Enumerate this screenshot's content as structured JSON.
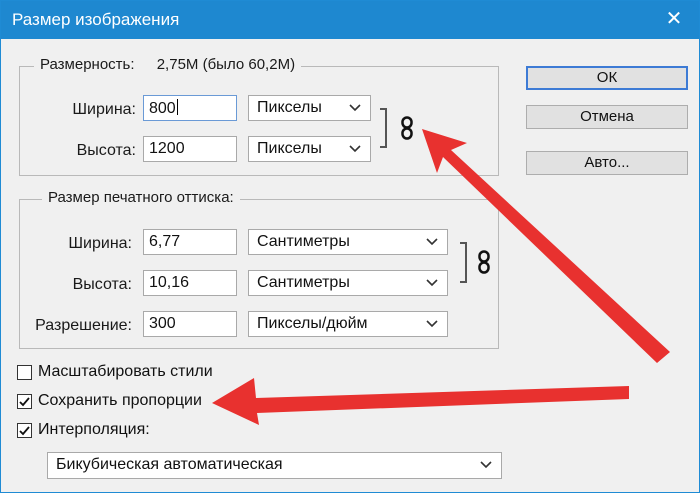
{
  "window": {
    "title": "Размер изображения",
    "close_glyph": "✕"
  },
  "pixel_dims": {
    "legend_label": "Размерность:",
    "legend_value": "2,75M (было 60,2M)",
    "width": {
      "label": "Ширина:",
      "value": "800",
      "unit": "Пикселы"
    },
    "height": {
      "label": "Высота:",
      "value": "1200",
      "unit": "Пикселы"
    }
  },
  "print_size": {
    "legend": "Размер печатного оттиска:",
    "width": {
      "label": "Ширина:",
      "value": "6,77",
      "unit": "Сантиметры"
    },
    "height": {
      "label": "Высота:",
      "value": "10,16",
      "unit": "Сантиметры"
    },
    "resolution": {
      "label": "Разрешение:",
      "value": "300",
      "unit": "Пикселы/дюйм"
    }
  },
  "buttons": {
    "ok": "ОК",
    "cancel": "Отмена",
    "auto": "Авто..."
  },
  "options": {
    "scale_styles": {
      "label": "Масштабировать стили",
      "checked": false
    },
    "constrain": {
      "label": "Сохранить пропорции",
      "checked": true
    },
    "resample": {
      "label": "Интерполяция:",
      "checked": true
    },
    "method": "Бикубическая автоматическая"
  },
  "colors": {
    "titlebar": "#1e88d0",
    "arrow": "#e8312f",
    "default_button_border": "#3d7bd5"
  }
}
